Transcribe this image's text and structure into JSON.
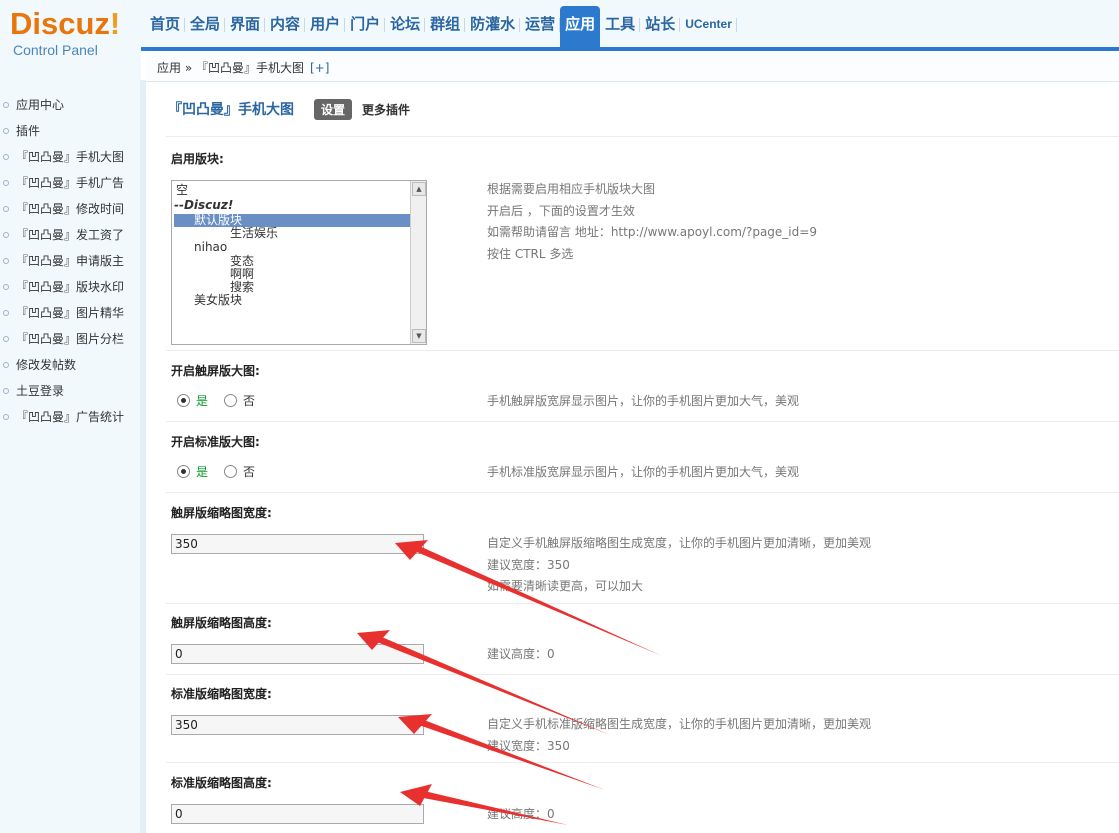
{
  "logo": {
    "brand": "Discuz",
    "brand_excl": "!",
    "subtitle": "Control Panel"
  },
  "nav": {
    "items": [
      "首页",
      "全局",
      "界面",
      "内容",
      "用户",
      "门户",
      "论坛",
      "群组",
      "防灌水",
      "运营",
      "应用",
      "工具",
      "站长",
      "UCenter"
    ],
    "active": "应用"
  },
  "breadcrumb": {
    "text": "应用 » 『凹凸曼』手机大图",
    "plus": "[+]"
  },
  "sidebar": {
    "items": [
      "应用中心",
      "插件",
      "『凹凸曼』手机大图",
      "『凹凸曼』手机广告",
      "『凹凸曼』修改时间",
      "『凹凸曼』发工资了",
      "『凹凸曼』申请版主",
      "『凹凸曼』版块水印",
      "『凹凸曼』图片精华",
      "『凹凸曼』图片分栏",
      "修改发帖数",
      "土豆登录",
      "『凹凸曼』广告统计"
    ]
  },
  "main": {
    "title": "『凹凸曼』手机大图",
    "settings_button": "设置",
    "more_plugins": "更多插件",
    "section1": {
      "label": "启用版块:",
      "options": [
        "空",
        "--Discuz!",
        "默认版块",
        "生活娱乐",
        "nihao",
        "变态",
        "啊啊",
        "搜索",
        "美女版块"
      ],
      "selected": "默认版块",
      "tips": [
        "根据需要启用相应手机版块大图",
        "开启后 ，下面的设置才生效",
        "如需帮助请留言 地址：http://www.apoyl.com/?page_id=9",
        "按住 CTRL 多选"
      ]
    },
    "section2": {
      "label": "开启触屏版大图:",
      "yes": "是",
      "no": "否",
      "tip": "手机触屏版宽屏显示图片，让你的手机图片更加大气，美观"
    },
    "section3": {
      "label": "开启标准版大图:",
      "yes": "是",
      "no": "否",
      "tip": "手机标准版宽屏显示图片，让你的手机图片更加大气，美观"
    },
    "section4": {
      "label": "触屏版缩略图宽度:",
      "value": "350",
      "tips": [
        "自定义手机触屏版缩略图生成宽度，让你的手机图片更加清晰，更加美观",
        "建议宽度：350",
        "如需要清晰读更高，可以加大"
      ]
    },
    "section5": {
      "label": "触屏版缩略图高度:",
      "value": "0",
      "tip": "建议高度：0"
    },
    "section6": {
      "label": "标准版缩略图宽度:",
      "value": "350",
      "tips": [
        "自定义手机标准版缩略图生成宽度，让你的手机图片更加清晰，更加美观",
        "建议宽度：350"
      ]
    },
    "section7": {
      "label": "标准版缩略图高度:",
      "value": "0",
      "tip": "建议高度：0"
    }
  },
  "colors": {
    "accent": "#2b7acd",
    "arrow": "#e8312f",
    "logo_orange": "#e8760c"
  }
}
